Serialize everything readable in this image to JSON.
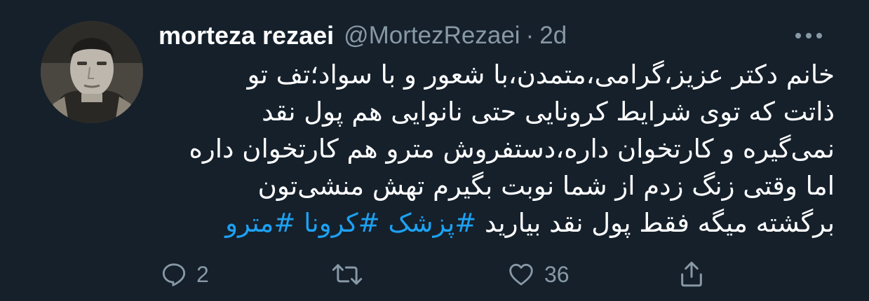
{
  "tweet": {
    "display_name": "morteza rezaei",
    "handle": "@MortezRezaei",
    "separator": "·",
    "time": "2d",
    "text_lines": [
      "خانم دکتر عزیز،گرامی،متمدن،با شعور و با سواد؛تف تو",
      "ذاتت که توی شرایط کرونایی حتی نانوایی هم پول نقد",
      "نمی‌گیره و کارتخوان داره،دستفروش مترو هم کارتخوان داره",
      "اما وقتی زنگ زدم از شما نوبت بگیرم تهش منشی‌تون",
      "برگشته میگه فقط پول نقد بیارید"
    ],
    "hashtags": [
      "#پزشک",
      "#کرونا",
      "#مترو"
    ]
  },
  "actions": {
    "reply": {
      "icon": "reply-icon",
      "count": "2"
    },
    "retweet": {
      "icon": "retweet-icon",
      "count": ""
    },
    "like": {
      "icon": "heart-icon",
      "count": "36"
    },
    "share": {
      "icon": "share-icon",
      "count": ""
    }
  },
  "colors": {
    "background": "#15202b",
    "text": "#ffffff",
    "secondary": "#8899a6",
    "accent": "#1da1f2"
  }
}
